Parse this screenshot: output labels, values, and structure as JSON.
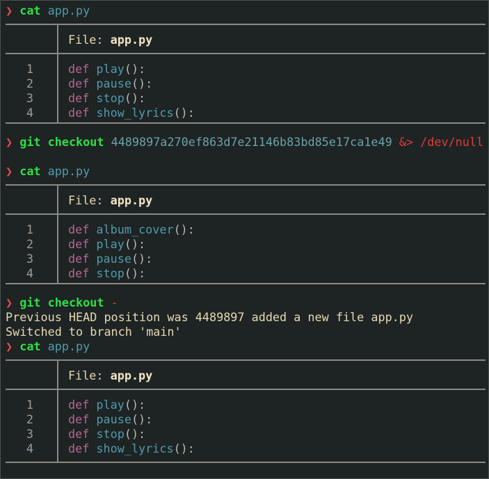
{
  "prompt_symbol": "❯",
  "blocks": [
    {
      "type": "command",
      "cmd": "cat",
      "arg": "app.py"
    },
    {
      "type": "file",
      "label": "File:",
      "filename": "app.py",
      "lines": [
        {
          "num": "1",
          "kw": "def",
          "fn": "play",
          "rest": "():"
        },
        {
          "num": "2",
          "kw": "def",
          "fn": "pause",
          "rest": "():"
        },
        {
          "num": "3",
          "kw": "def",
          "fn": "stop",
          "rest": "():"
        },
        {
          "num": "4",
          "kw": "def",
          "fn": "show_lyrics",
          "rest": "():"
        }
      ]
    },
    {
      "type": "command",
      "cmd": "git checkout",
      "arg": "4489897a270ef863d7e21146b83bd85e17ca1e49",
      "redirect": "&>",
      "target": "/dev/null"
    },
    {
      "type": "command",
      "cmd": "cat",
      "arg": "app.py"
    },
    {
      "type": "file",
      "label": "File:",
      "filename": "app.py",
      "lines": [
        {
          "num": "1",
          "kw": "def",
          "fn": "album_cover",
          "rest": "():"
        },
        {
          "num": "2",
          "kw": "def",
          "fn": "play",
          "rest": "():"
        },
        {
          "num": "3",
          "kw": "def",
          "fn": "pause",
          "rest": "():"
        },
        {
          "num": "4",
          "kw": "def",
          "fn": "stop",
          "rest": "():"
        }
      ]
    },
    {
      "type": "command",
      "cmd": "git checkout",
      "arg": "-"
    },
    {
      "type": "output",
      "lines": [
        "Previous HEAD position was 4489897 added a new file app.py",
        "Switched to branch 'main'"
      ]
    },
    {
      "type": "command",
      "cmd": "cat",
      "arg": "app.py"
    },
    {
      "type": "file",
      "label": "File:",
      "filename": "app.py",
      "lines": [
        {
          "num": "1",
          "kw": "def",
          "fn": "play",
          "rest": "():"
        },
        {
          "num": "2",
          "kw": "def",
          "fn": "pause",
          "rest": "():"
        },
        {
          "num": "3",
          "kw": "def",
          "fn": "stop",
          "rest": "():"
        },
        {
          "num": "4",
          "kw": "def",
          "fn": "show_lyrics",
          "rest": "():"
        }
      ]
    }
  ]
}
